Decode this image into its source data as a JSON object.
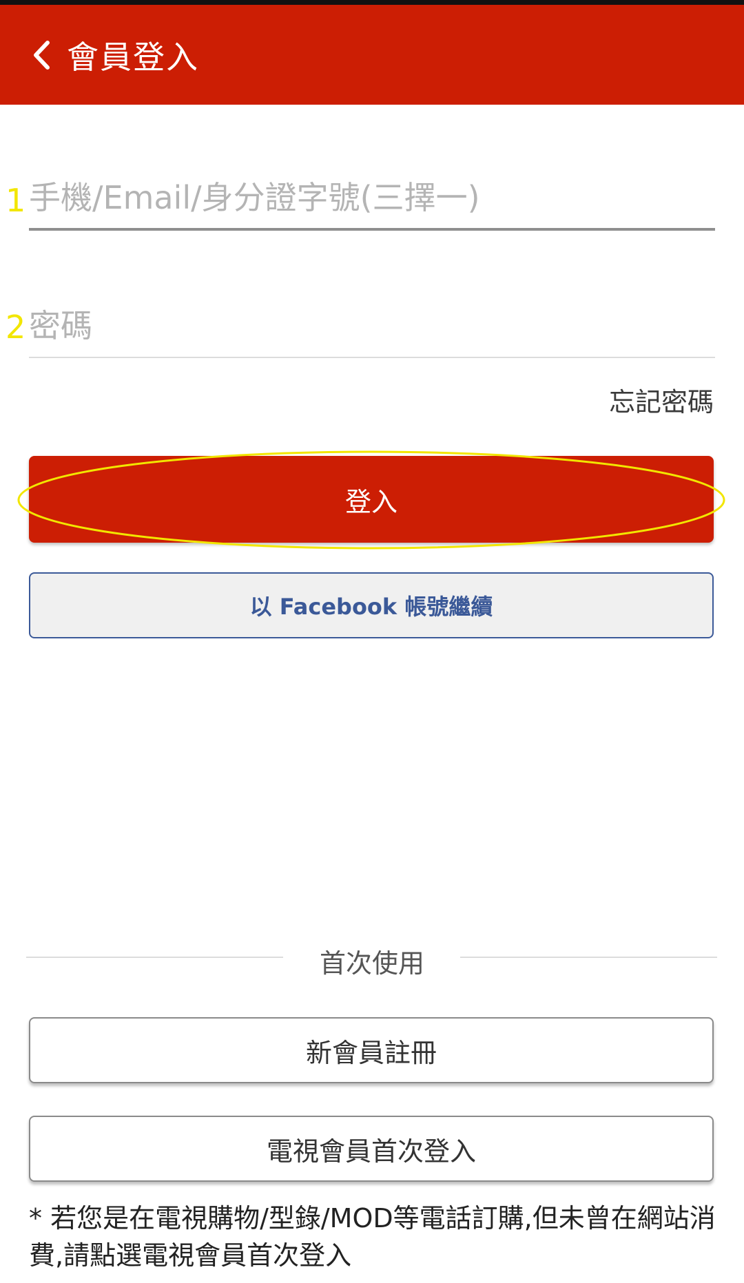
{
  "header": {
    "title": "會員登入"
  },
  "form": {
    "account_placeholder": "手機/Email/身分證字號(三擇一)",
    "password_placeholder": "密碼",
    "account_marker": "1",
    "password_marker": "2",
    "forgot_password_label": "忘記密碼"
  },
  "actions": {
    "login_label": "登入",
    "facebook_label": "以 Facebook 帳號繼續"
  },
  "first_time": {
    "divider_label": "首次使用",
    "register_label": "新會員註冊",
    "tv_member_label": "電視會員首次登入",
    "note": "* 若您是在電視購物/型錄/MOD等電話訂購,但未曾在網站消費,請點選電視會員首次登入"
  },
  "colors": {
    "brand_red": "#cc1e04",
    "facebook_blue": "#3b5998",
    "annotation_yellow": "#f2e600"
  },
  "icons": {
    "back": "chevron-left-icon"
  }
}
